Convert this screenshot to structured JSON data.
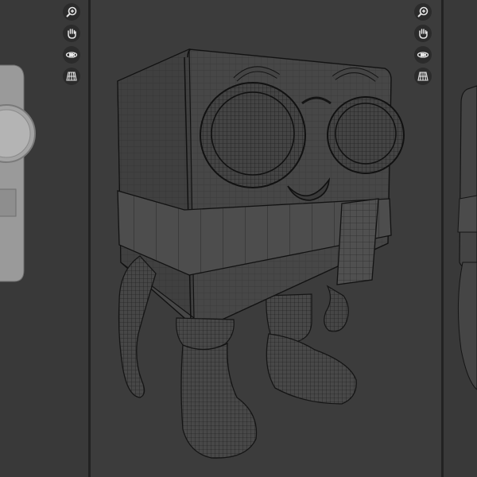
{
  "app": {
    "kind": "3d-viewport-multiview"
  },
  "viewports": [
    {
      "id": "left",
      "shading": "solid"
    },
    {
      "id": "center",
      "shading": "wireframe"
    },
    {
      "id": "right",
      "shading": "wireframe"
    }
  ],
  "navigation": {
    "buttons": [
      {
        "name": "zoom",
        "icon": "zoom-icon"
      },
      {
        "name": "pan",
        "icon": "hand-pan-icon"
      },
      {
        "name": "camera",
        "icon": "camera-orbit-icon"
      },
      {
        "name": "perspective",
        "icon": "perspective-grid-icon"
      }
    ]
  },
  "colors": {
    "background": "#3a3a3a",
    "wire": "#151515",
    "mesh_fill": "#4a4a4a",
    "solid_fill": "#9a9a9a",
    "icon": "#e6e6e6"
  }
}
